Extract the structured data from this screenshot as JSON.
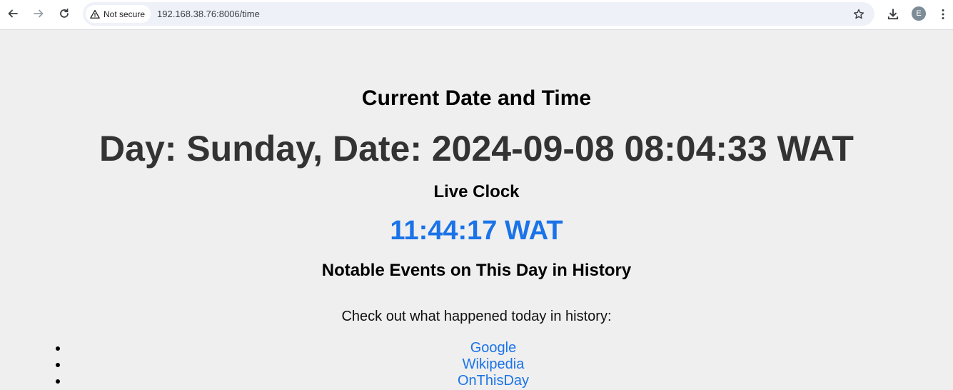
{
  "browser": {
    "security_label": "Not secure",
    "url": "192.168.38.76:8006/time",
    "profile_initial": "E"
  },
  "page": {
    "title": "Current Date and Time",
    "datetime": "Day: Sunday, Date: 2024-09-08 08:04:33 WAT",
    "live_clock_heading": "Live Clock",
    "live_clock_value": "11:44:17 WAT",
    "events_heading": "Notable Events on This Day in History",
    "events_intro": "Check out what happened today in history:",
    "links": [
      {
        "label": "Google"
      },
      {
        "label": "Wikipedia"
      },
      {
        "label": "OnThisDay"
      }
    ]
  },
  "colors": {
    "link": "#1a73e8",
    "clock": "#1a73e8",
    "page_background": "#efefef"
  }
}
